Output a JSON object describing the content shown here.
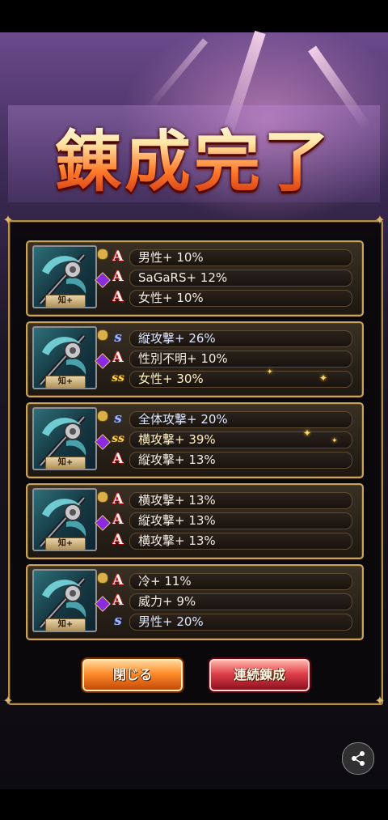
{
  "title": "錬成完了",
  "cards": [
    {
      "weapon_tag": "知+",
      "rows": [
        {
          "rank": "A",
          "text": "男性+ 10%"
        },
        {
          "rank": "A",
          "text": "SaGaRS+ 12%"
        },
        {
          "rank": "A",
          "text": "女性+ 10%"
        }
      ]
    },
    {
      "weapon_tag": "知+",
      "rows": [
        {
          "rank": "S",
          "text": "縦攻撃+ 26%"
        },
        {
          "rank": "A",
          "text": "性別不明+ 10%"
        },
        {
          "rank": "SS",
          "text": "女性+ 30%"
        }
      ]
    },
    {
      "weapon_tag": "知+",
      "rows": [
        {
          "rank": "S",
          "text": "全体攻撃+ 20%"
        },
        {
          "rank": "SS",
          "text": "横攻撃+ 39%"
        },
        {
          "rank": "A",
          "text": "縦攻撃+ 13%"
        }
      ]
    },
    {
      "weapon_tag": "知+",
      "rows": [
        {
          "rank": "A",
          "text": "横攻撃+ 13%"
        },
        {
          "rank": "A",
          "text": "縦攻撃+ 13%"
        },
        {
          "rank": "A",
          "text": "横攻撃+ 13%"
        }
      ]
    },
    {
      "weapon_tag": "知+",
      "rows": [
        {
          "rank": "A",
          "text": "冷+ 11%"
        },
        {
          "rank": "A",
          "text": "威力+ 9%"
        },
        {
          "rank": "S",
          "text": "男性+ 20%"
        }
      ]
    }
  ],
  "buttons": {
    "close_label": "閉じる",
    "again_label": "連続錬成"
  },
  "icons": {
    "rank_a": "rank-a-icon",
    "rank_s": "rank-s-icon",
    "rank_ss": "rank-ss-icon",
    "share": "share-icon"
  },
  "colors": {
    "frame_gold": "#c9a55a",
    "close_button": "#ff8c2a",
    "again_button": "#e0404a"
  }
}
